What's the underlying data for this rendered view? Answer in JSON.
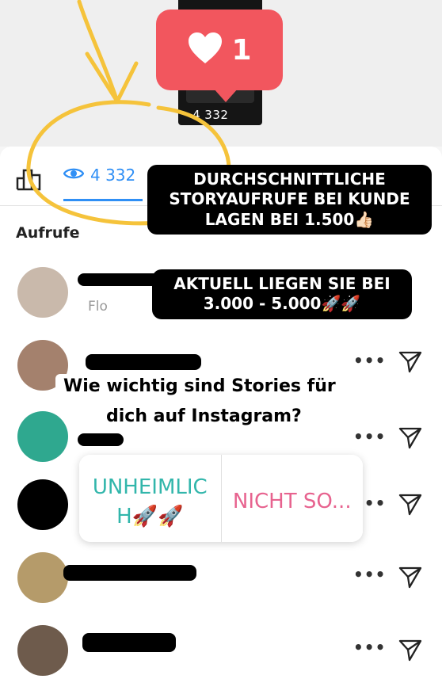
{
  "story": {
    "thumb_label": "4 332",
    "like_count": "1"
  },
  "tabs": {
    "views_count": "4 332"
  },
  "section": {
    "title": "Aufrufe"
  },
  "rows": [
    {
      "sub": "Flo"
    },
    {
      "sub": ""
    },
    {
      "sub": ""
    },
    {
      "sub": ""
    },
    {
      "sub": ""
    },
    {
      "sub": ""
    }
  ],
  "overlays": {
    "text1": "DURCHSCHNITTLICHE STORYAUFRUFE BEI KUNDE LAGEN BEI 1.500👍🏻",
    "text2": "AKTUELL LIEGEN SIE BEI 3.000 - 5.000🚀🚀"
  },
  "question": {
    "line1": "Wie wichtig sind Stories für",
    "line2": "dich auf Instagram?"
  },
  "poll": {
    "option_a": "UNHEIMLIC H🚀🚀",
    "option_b": "NICHT SO..."
  },
  "colors": {
    "accent": "#2f8ff5",
    "like": "#f2565e",
    "annotation": "#f5c33b",
    "poll_a": "#32b6ab",
    "poll_b": "#e7638f"
  }
}
